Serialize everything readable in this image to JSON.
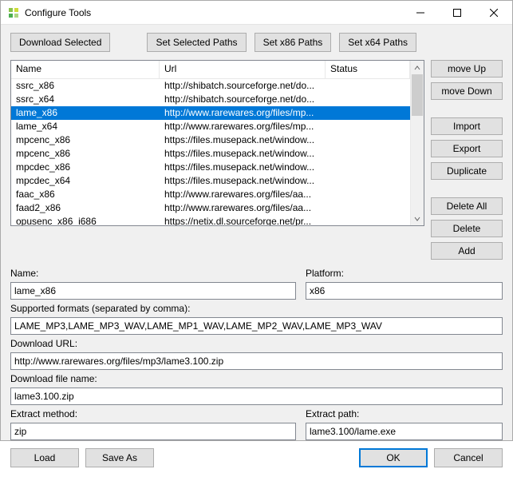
{
  "window": {
    "title": "Configure Tools"
  },
  "topButtons": {
    "downloadSelected": "Download Selected",
    "setSelectedPaths": "Set Selected Paths",
    "setX86Paths": "Set x86 Paths",
    "setX64Paths": "Set x64 Paths"
  },
  "table": {
    "headers": {
      "name": "Name",
      "url": "Url",
      "status": "Status"
    },
    "rows": [
      {
        "name": "ssrc_x86",
        "url": "http://shibatch.sourceforge.net/do...",
        "status": "",
        "selected": false
      },
      {
        "name": "ssrc_x64",
        "url": "http://shibatch.sourceforge.net/do...",
        "status": "",
        "selected": false
      },
      {
        "name": "lame_x86",
        "url": "http://www.rarewares.org/files/mp...",
        "status": "",
        "selected": true
      },
      {
        "name": "lame_x64",
        "url": "http://www.rarewares.org/files/mp...",
        "status": "",
        "selected": false
      },
      {
        "name": "mpcenc_x86",
        "url": "https://files.musepack.net/window...",
        "status": "",
        "selected": false
      },
      {
        "name": "mpcenc_x86",
        "url": "https://files.musepack.net/window...",
        "status": "",
        "selected": false
      },
      {
        "name": "mpcdec_x86",
        "url": "https://files.musepack.net/window...",
        "status": "",
        "selected": false
      },
      {
        "name": "mpcdec_x64",
        "url": "https://files.musepack.net/window...",
        "status": "",
        "selected": false
      },
      {
        "name": "faac_x86",
        "url": "http://www.rarewares.org/files/aa...",
        "status": "",
        "selected": false
      },
      {
        "name": "faad2_x86",
        "url": "http://www.rarewares.org/files/aa...",
        "status": "",
        "selected": false
      },
      {
        "name": "opusenc_x86_i686",
        "url": "https://netix.dl.sourceforge.net/pr...",
        "status": "",
        "selected": false
      }
    ]
  },
  "sideButtons": {
    "moveUp": "move Up",
    "moveDown": "move Down",
    "import": "Import",
    "export": "Export",
    "duplicate": "Duplicate",
    "deleteAll": "Delete All",
    "delete": "Delete",
    "add": "Add"
  },
  "form": {
    "nameLabel": "Name:",
    "nameValue": "lame_x86",
    "platformLabel": "Platform:",
    "platformValue": "x86",
    "formatsLabel": "Supported formats (separated by comma):",
    "formatsValue": "LAME_MP3,LAME_MP3_WAV,LAME_MP1_WAV,LAME_MP2_WAV,LAME_MP3_WAV",
    "downloadUrlLabel": "Download URL:",
    "downloadUrlValue": "http://www.rarewares.org/files/mp3/lame3.100.zip",
    "downloadFileLabel": "Download file name:",
    "downloadFileValue": "lame3.100.zip",
    "extractMethodLabel": "Extract method:",
    "extractMethodValue": "zip",
    "extractPathLabel": "Extract path:",
    "extractPathValue": "lame3.100/lame.exe"
  },
  "bottomButtons": {
    "load": "Load",
    "saveAs": "Save As",
    "ok": "OK",
    "cancel": "Cancel"
  }
}
